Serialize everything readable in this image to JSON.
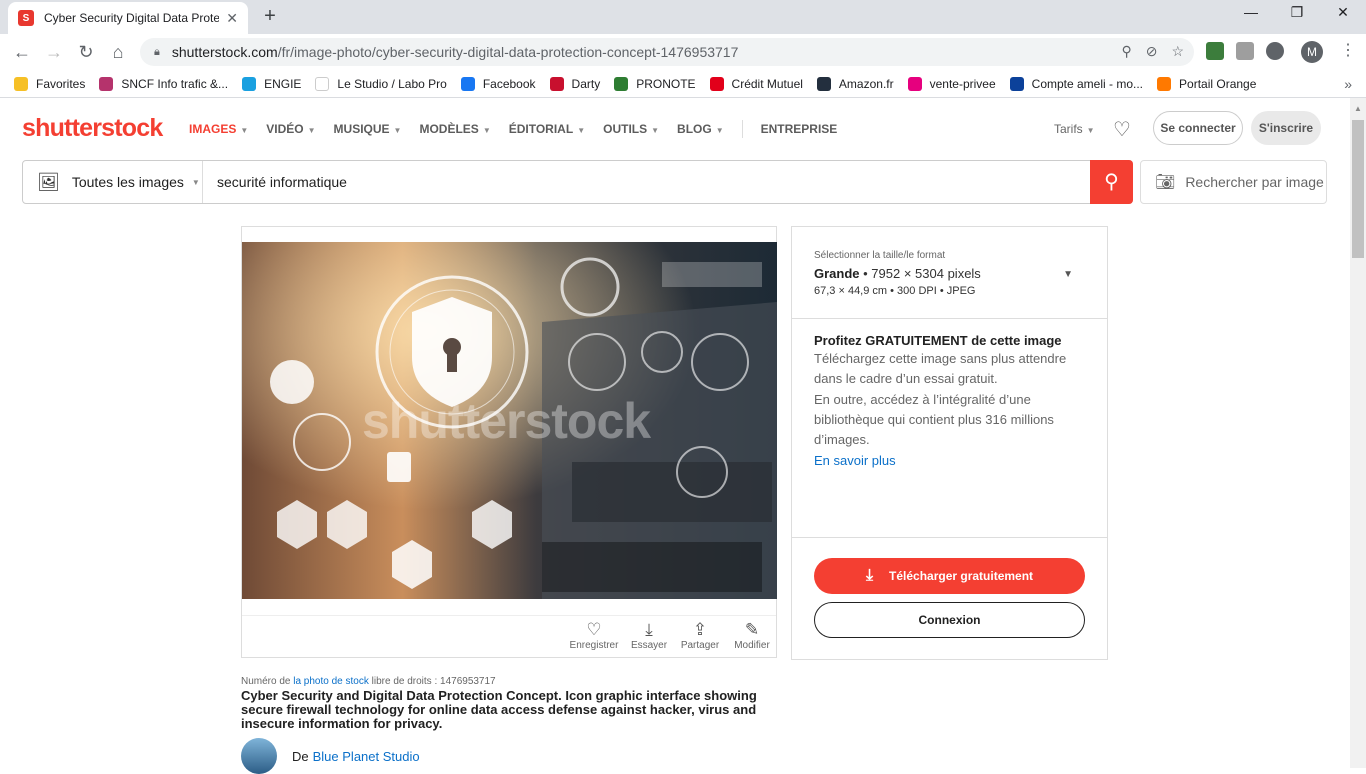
{
  "browser": {
    "tab_title": "Cyber Security Digital Data Prote",
    "url_host": "shutterstock.com",
    "url_path": "/fr/image-photo/cyber-security-digital-data-protection-concept-1476953717",
    "profile_initial": "M",
    "bookmarks": [
      {
        "label": "Favorites",
        "color": "#f6c026"
      },
      {
        "label": "SNCF Info trafic &...",
        "color": "#b5336c"
      },
      {
        "label": "ENGIE",
        "color": "#1aa0e0"
      },
      {
        "label": "Le Studio / Labo Pro",
        "color": "#ffffff"
      },
      {
        "label": "Facebook",
        "color": "#1877f2"
      },
      {
        "label": "Darty",
        "color": "#c8102e"
      },
      {
        "label": "PRONOTE",
        "color": "#2e7d32"
      },
      {
        "label": "Crédit Mutuel",
        "color": "#e2001a"
      },
      {
        "label": "Amazon.fr",
        "color": "#232f3e"
      },
      {
        "label": "vente-privee",
        "color": "#e6007e"
      },
      {
        "label": "Compte ameli - mo...",
        "color": "#0c419a"
      },
      {
        "label": "Portail Orange",
        "color": "#ff7900"
      }
    ]
  },
  "header": {
    "logo": "shutterstock",
    "nav": [
      "IMAGES",
      "VIDÉO",
      "MUSIQUE",
      "MODÈLES",
      "ÉDITORIAL",
      "OUTILS",
      "BLOG"
    ],
    "enterprise": "ENTREPRISE",
    "tarifs": "Tarifs",
    "connect": "Se connecter",
    "signup": "S'inscrire"
  },
  "search": {
    "type": "Toutes les images",
    "query": "securité informatique",
    "image_search": "Rechercher par image"
  },
  "image": {
    "watermark": "shutterstock",
    "actions": [
      "Enregistrer",
      "Essayer",
      "Partager",
      "Modifier"
    ],
    "stock_prefix": "Numéro de",
    "stock_link": "la photo de stock",
    "stock_suffix": "libre de droits : 1476953717",
    "title": "Cyber Security and Digital Data Protection Concept. Icon graphic interface showing secure firewall technology for online data access defense against hacker, virus and insecure information for privacy.",
    "author_prefix": "De",
    "author": "Blue Planet Studio"
  },
  "details": {
    "size_label": "Sélectionner la taille/le format",
    "size_name": "Grande",
    "size_pixels": "• 7952 × 5304 pixels",
    "size_sub": "67,3 × 44,9 cm • 300 DPI • JPEG",
    "promo_title": "Profitez GRATUITEMENT de cette image",
    "promo_text1": "Téléchargez cette image sans plus attendre dans le cadre d’un essai gratuit.",
    "promo_text2": "En outre, accédez à l’intégralité d’une bibliothèque qui contient plus 316 millions d’images.",
    "promo_link": "En savoir plus",
    "download": "Télécharger gratuitement",
    "login": "Connexion"
  },
  "colors": {
    "brand": "#f43f32",
    "link": "#0b70c9"
  }
}
